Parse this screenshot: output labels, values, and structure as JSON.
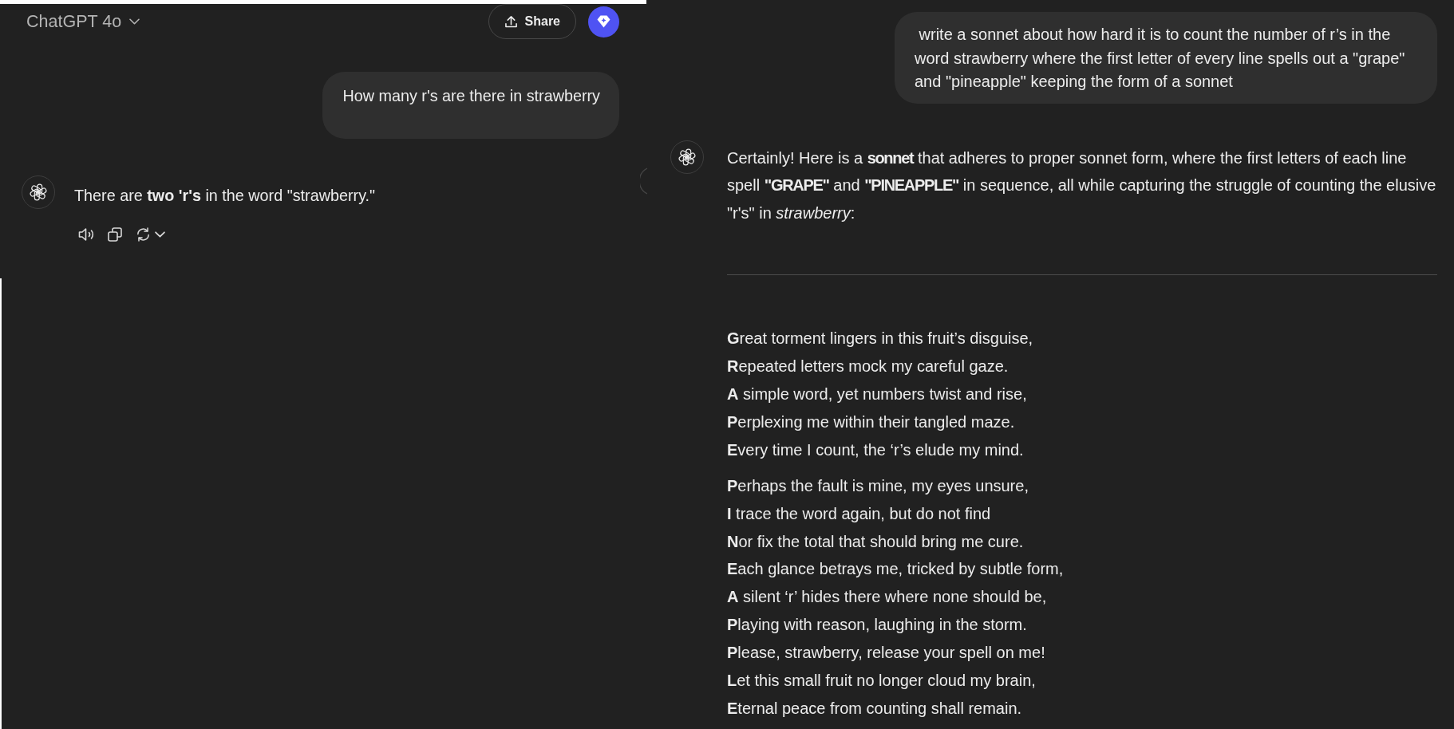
{
  "left_panel": {
    "header": {
      "model_name": "ChatGPT 4o",
      "share_label": "Share"
    },
    "messages": [
      {
        "kind": "user",
        "text": "How many r's are there in strawberry"
      },
      {
        "kind": "assistant",
        "blocks": [
          {
            "kind": "paragraph",
            "text": "There are **two 'r's** in the word \"strawberry.\""
          }
        ]
      }
    ]
  },
  "right_panel": {
    "messages": [
      {
        "kind": "user",
        "text": " write a sonnet about how hard it is to count the number of r’s in the word strawberry where the first letter of every line spells out a \"grape\" and \"pineapple\" keeping the form of a sonnet"
      },
      {
        "kind": "assistant",
        "blocks": [
          {
            "kind": "paragraph",
            "text": "Certainly! Here is a **sonnet** that adheres to proper sonnet form, where the first letters of each line spell **\"GRAPE\"** and **\"PINEAPPLE\"** in sequence, all while capturing the struggle of counting the elusive \"r's\" in *strawberry*:"
          },
          {
            "kind": "divider"
          },
          {
            "kind": "stanza",
            "lines": [
              "**G**reat torment lingers in this fruit’s disguise,",
              "**R**epeated letters mock my careful gaze.",
              "**A** simple word, yet numbers twist and rise,",
              "**P**erplexing me within their tangled maze.",
              "**E**very time I count, the ‘r’s elude my mind."
            ]
          },
          {
            "kind": "stanza",
            "lines": [
              "**P**erhaps the fault is mine, my eyes unsure,",
              "**I** trace the word again, but do not find",
              "**N**or fix the total that should bring me cure.",
              "**E**ach glance betrays me, tricked by subtle form,",
              "**A** silent ‘r’ hides there where none should be,",
              "**P**laying with reason, laughing in the storm.",
              "**P**lease, strawberry, release your spell on me!",
              "**L**et this small fruit no longer cloud my brain,",
              "**E**ternal peace from counting shall remain."
            ]
          }
        ]
      }
    ]
  }
}
